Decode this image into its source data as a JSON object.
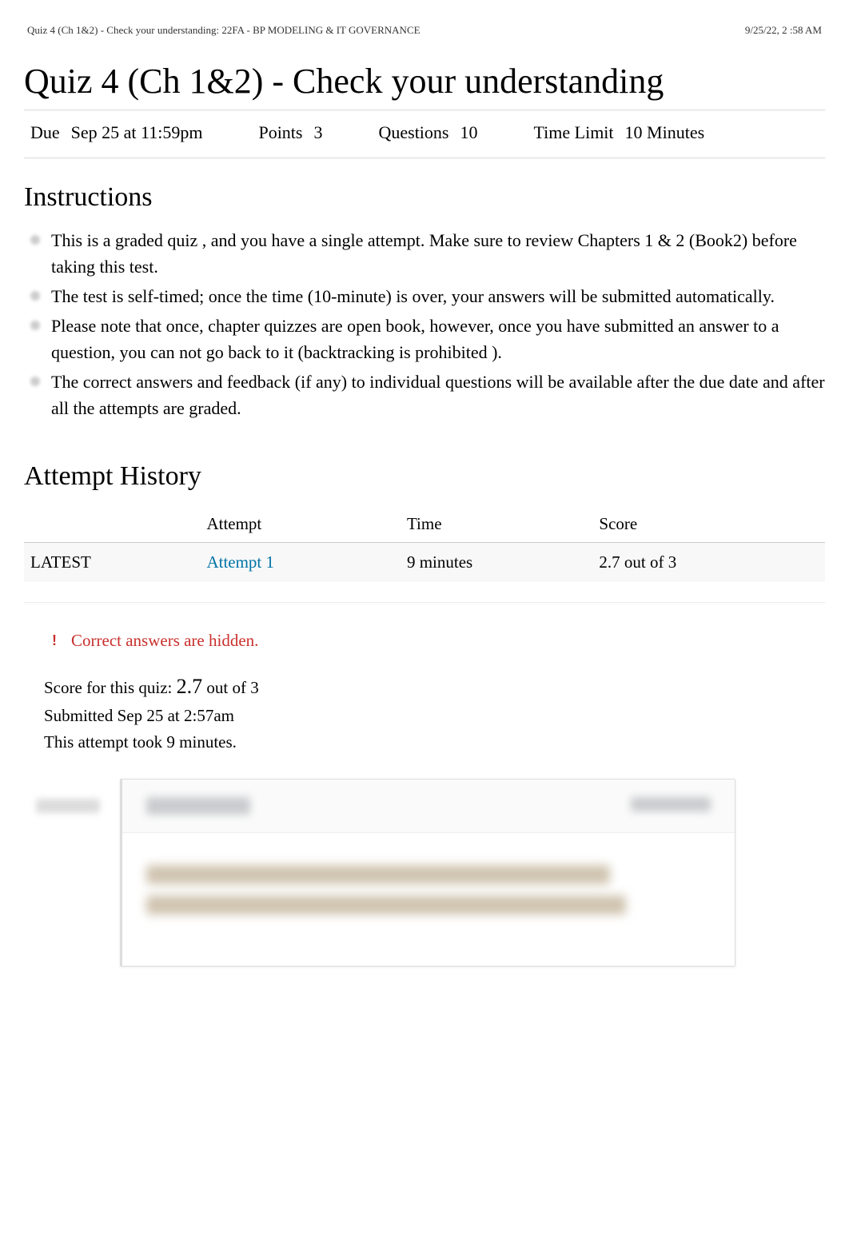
{
  "header": {
    "left": "Quiz 4 (Ch 1&2) - Check your understanding: 22FA - BP MODELING & IT GOVERNANCE",
    "right": "9/25/22, 2 :58 AM"
  },
  "title": "Quiz 4 (Ch 1&2) - Check your understanding",
  "meta": {
    "due_label": "Due",
    "due_value": "Sep 25 at 11:59pm",
    "points_label": "Points",
    "points_value": "3",
    "questions_label": "Questions",
    "questions_value": "10",
    "timelimit_label": "Time Limit",
    "timelimit_value": "10 Minutes"
  },
  "instructions": {
    "heading": "Instructions",
    "items": [
      "This is a graded quiz , and you have a  single attempt.   Make sure to review Chapters 1 & 2 (Book2) before taking this test.",
      "The test is self-timed; once the time (10-minute) is over, your answers will be submitted automatically.",
      "Please note that once,   chapter quizzes are open book, however, once you have submitted an answer to a question,  you can not go back to it   (backtracking is prohibited   ).",
      "The correct answers and feedback (if any) to individual questions will be available after the due date and after all the attempts are graded."
    ]
  },
  "history": {
    "heading": "Attempt History",
    "columns": {
      "attempt": "Attempt",
      "time": "Time",
      "score": "Score"
    },
    "rows": [
      {
        "status": "LATEST",
        "attempt": "Attempt 1",
        "time": "9 minutes",
        "score": "2.7 out of 3"
      }
    ]
  },
  "hidden_notice": {
    "icon": "!",
    "text": "Correct answers are hidden."
  },
  "score_block": {
    "line1_prefix": "Score for this quiz: ",
    "line1_score": "2.7",
    "line1_suffix": " out of 3",
    "line2": "Submitted Sep 25 at 2:57am",
    "line3": "This attempt took 9 minutes."
  }
}
